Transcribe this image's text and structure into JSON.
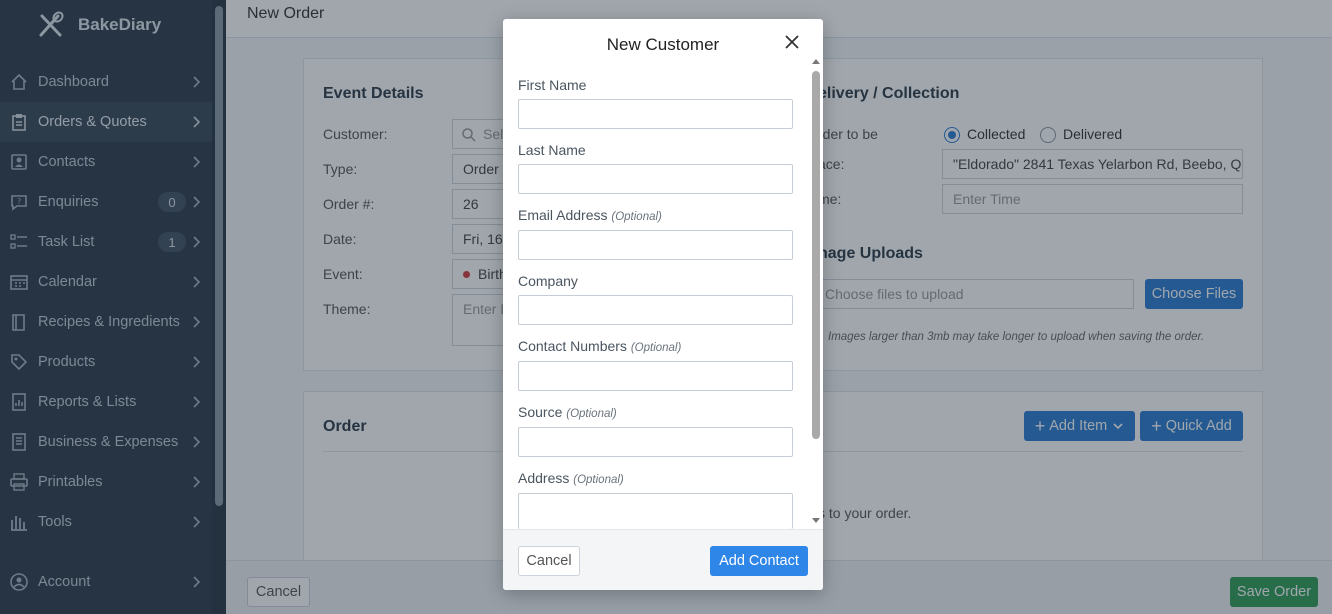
{
  "app": {
    "name": "BakeDiary"
  },
  "sidebar": {
    "items": [
      {
        "label": "Dashboard",
        "icon": "home-icon"
      },
      {
        "label": "Orders & Quotes",
        "icon": "clipboard-icon",
        "active": true
      },
      {
        "label": "Contacts",
        "icon": "contacts-icon"
      },
      {
        "label": "Enquiries",
        "icon": "enquiry-icon",
        "badge": "0"
      },
      {
        "label": "Task List",
        "icon": "tasklist-icon",
        "badge": "1"
      },
      {
        "label": "Calendar",
        "icon": "calendar-icon"
      },
      {
        "label": "Recipes & Ingredients",
        "icon": "book-icon"
      },
      {
        "label": "Products",
        "icon": "tag-icon"
      },
      {
        "label": "Reports & Lists",
        "icon": "report-icon"
      },
      {
        "label": "Business & Expenses",
        "icon": "ledger-icon"
      },
      {
        "label": "Printables",
        "icon": "printer-icon"
      },
      {
        "label": "Tools",
        "icon": "tools-icon"
      },
      {
        "label": "Account",
        "icon": "account-icon"
      }
    ]
  },
  "page": {
    "title": "New Order",
    "event_details": {
      "heading": "Event Details",
      "customer_label": "Customer:",
      "customer_placeholder": "Sel",
      "type_label": "Type:",
      "type_value": "Order",
      "order_no_label": "Order #:",
      "order_no_value": "26",
      "date_label": "Date:",
      "date_value": "Fri, 16",
      "event_label": "Event:",
      "event_value": "Birth",
      "theme_label": "Theme:",
      "theme_placeholder": "Enter D"
    },
    "delivery": {
      "heading": "elivery / Collection",
      "order_to_be_label": "rder to be",
      "option_collected": "Collected",
      "option_delivered": "Delivered",
      "place_label": "ace:",
      "place_value": "\"Eldorado\" 2841 Texas Yelarbon Rd, Beebo, Q",
      "time_label": "me:",
      "time_placeholder": "Enter Time"
    },
    "uploads": {
      "heading": "nage Uploads",
      "file_placeholder": "Choose files to upload",
      "choose_button": "Choose Files",
      "note": "Images larger than 3mb may take longer to upload when saving the order."
    },
    "order": {
      "heading": "Order",
      "add_item_button": "Add Item",
      "quick_add_button": "Quick Add",
      "empty_text": "s to your order."
    },
    "footer": {
      "cancel_button": "Cancel",
      "save_button": "Save Order"
    }
  },
  "modal": {
    "title": "New Customer",
    "optional_tag": "(Optional)",
    "fields": {
      "first_name": "First Name",
      "last_name": "Last Name",
      "email": "Email Address",
      "company": "Company",
      "contact_numbers": "Contact Numbers",
      "source": "Source",
      "address": "Address"
    },
    "cancel_button": "Cancel",
    "add_button": "Add Contact"
  },
  "colors": {
    "sidebar_bg": "#2e3b4a",
    "primary_blue": "#2a7bd3",
    "save_green": "#2f9e55"
  }
}
